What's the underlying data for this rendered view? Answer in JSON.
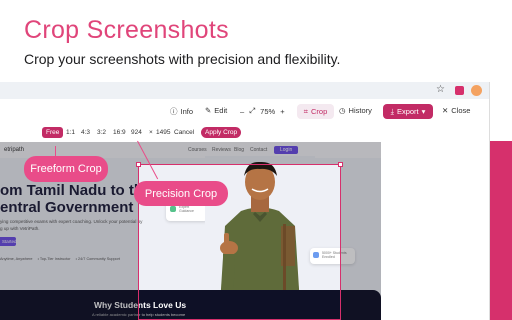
{
  "header": {
    "title": "Crop Screenshots",
    "subtitle": "Crop your screenshots with precision and flexibility."
  },
  "colors": {
    "accent": "#d6306c",
    "callout": "#e94c89",
    "site_primary": "#6c4ee6",
    "dark_band": "#0e1026"
  },
  "browser": {
    "icons": [
      "star-icon",
      "extension-icon",
      "avatar"
    ]
  },
  "toolbar": {
    "info": "Info",
    "edit": "Edit",
    "zoom_out": "–",
    "zoom_value": "75%",
    "zoom_in": "+",
    "crop": "Crop",
    "history": "History",
    "export": "Export",
    "close": "Close"
  },
  "crop_toolbar": {
    "free": "Free",
    "ratios": [
      "1:1",
      "4:3",
      "3:2",
      "16:9"
    ],
    "width": "924",
    "times": "×",
    "height": "1495",
    "cancel": "Cancel",
    "apply": "Apply Crop"
  },
  "site": {
    "logo_text": "etripath",
    "nav": [
      "Courses",
      "Reviews",
      "Blog",
      "Contact"
    ],
    "login": "Login",
    "hero_line1": "om Tamil Nadu to th",
    "hero_line2": "entral Government",
    "desc_line1": "ying competitive exams with expert coaching. Unlock your potential by",
    "desc_line2": "g up with VetriPath.",
    "cta": "Started",
    "features": [
      "Anytime, Anywhere",
      "• Top-Tier Instructor",
      "• 24/7 Community Support"
    ],
    "card_mid_line1": "Expert",
    "card_mid_line2": "Guidance",
    "card_right_line1": "5000+ Students",
    "card_right_line2": "Enrolled",
    "why_title": "Why Students Love Us",
    "why_sub": "A reliable academic partner to help students become"
  },
  "callouts": {
    "freeform": "Freeform Crop",
    "precision": "Precision Crop"
  }
}
